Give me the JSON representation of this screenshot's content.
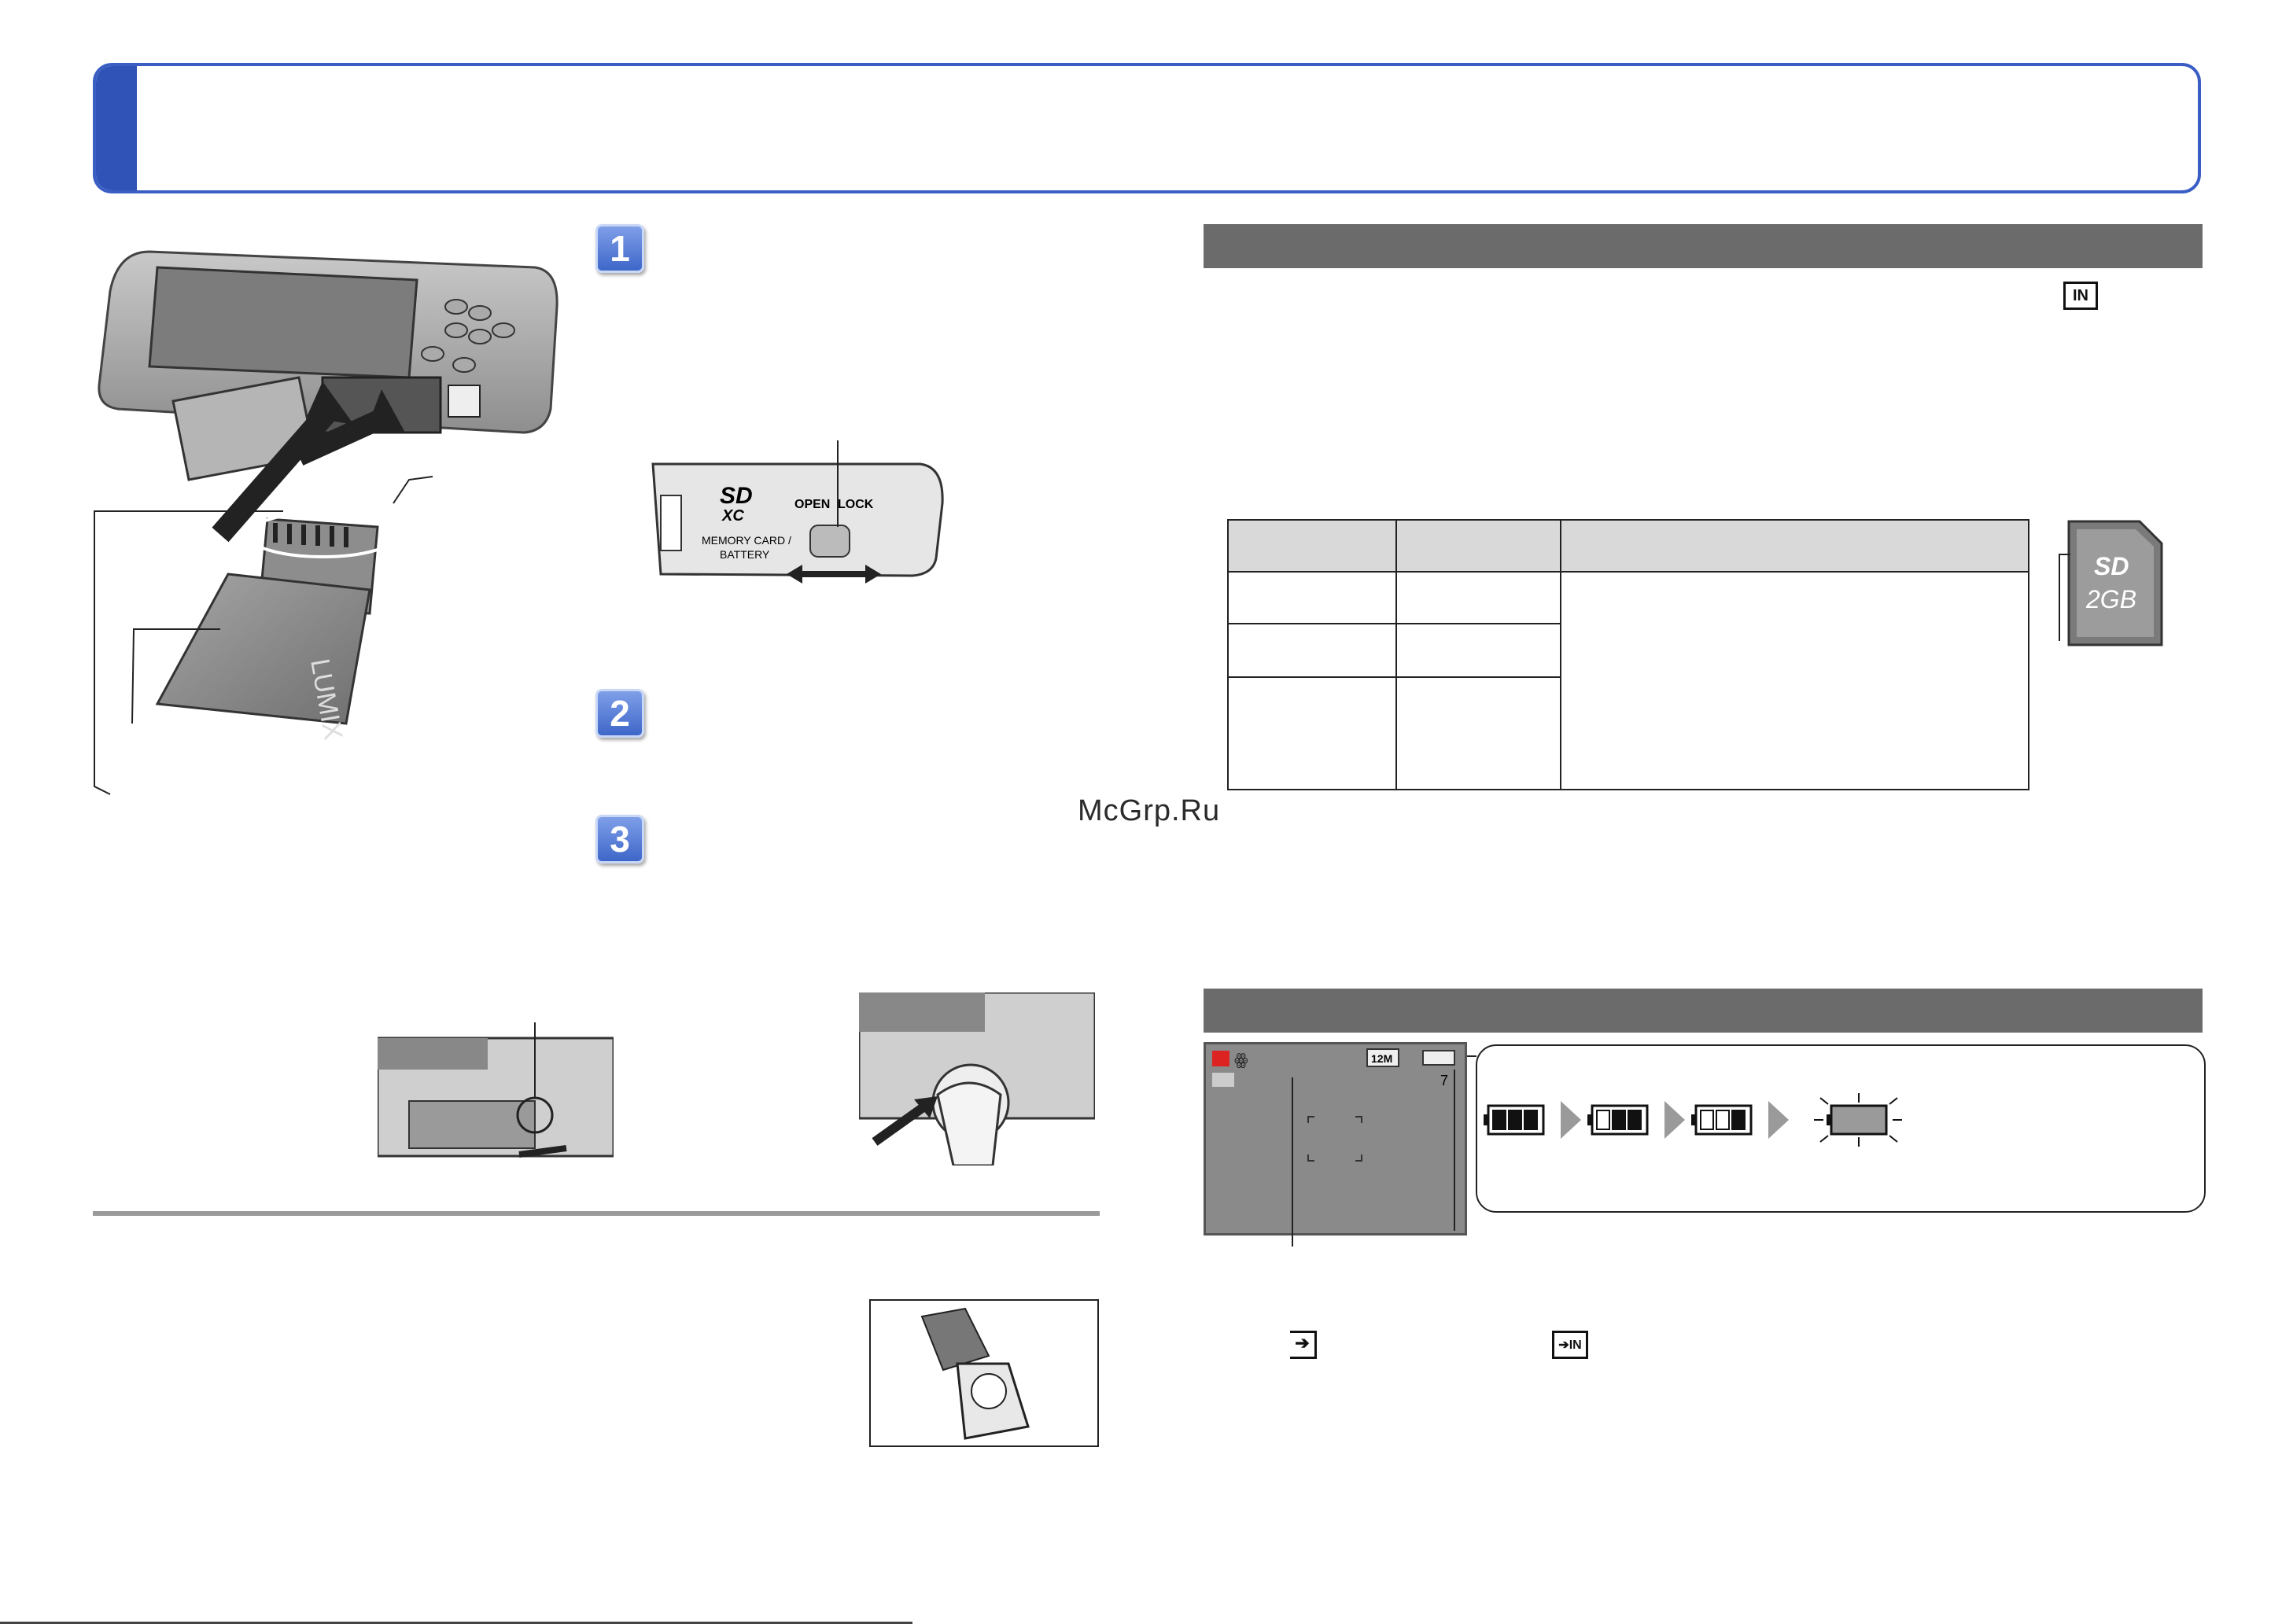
{
  "section_icons": {
    "builtin_memory": "IN-memory-icon",
    "copy_to_card": "card-destination-icon",
    "copy_to_builtin": "built-in-memory-destination-icon"
  },
  "camera_lock": {
    "open_label": "OPEN",
    "lock_label": "LOCK",
    "slot_label_line1": "MEMORY CARD /",
    "slot_label_line2": "BATTERY",
    "card_logo_line1": "SD",
    "card_logo_line2": "XC"
  },
  "battery_brand": "LUMIX",
  "sd_card": {
    "logo": "SD",
    "capacity": "2GB"
  },
  "lcd": {
    "resolution_badge": "12M",
    "remaining_count": "7"
  },
  "battery_levels": [
    3,
    2,
    1,
    0
  ],
  "steps": [
    "1",
    "2",
    "3"
  ],
  "watermark": "McGrp.Ru",
  "colors": {
    "brand_blue": "#2f53b7",
    "section_gray": "#6b6b6b",
    "table_header": "#d9d9d9"
  }
}
